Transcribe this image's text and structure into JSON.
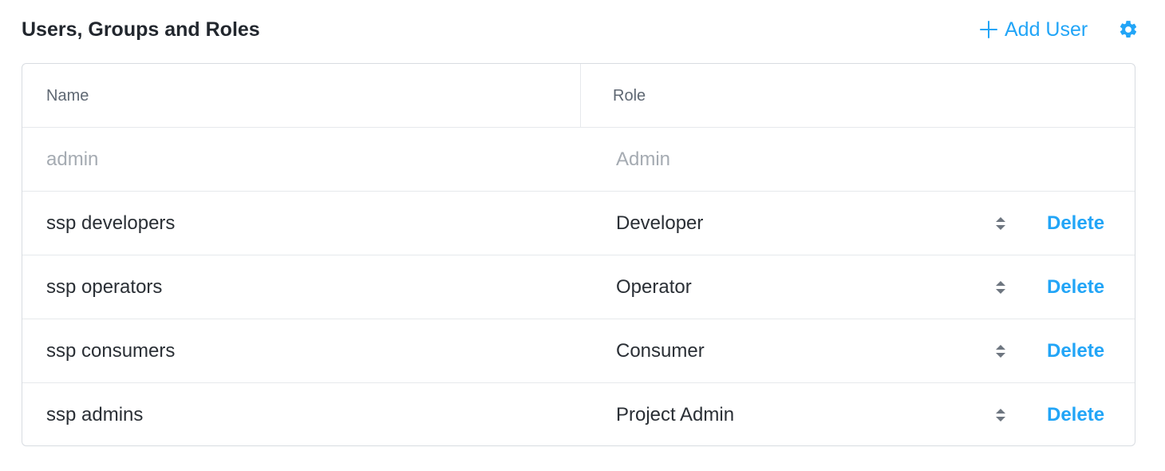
{
  "section": {
    "title": "Users, Groups and Roles",
    "add_user_label": "Add User",
    "add_icon": "plus-icon",
    "settings_icon": "gear-icon"
  },
  "table": {
    "columns": [
      "Name",
      "Role"
    ],
    "rows": [
      {
        "name": "admin",
        "role": "Admin",
        "editable": false
      },
      {
        "name": "ssp developers",
        "role": "Developer",
        "editable": true,
        "action": "Delete"
      },
      {
        "name": "ssp operators",
        "role": "Operator",
        "editable": true,
        "action": "Delete"
      },
      {
        "name": "ssp consumers",
        "role": "Consumer",
        "editable": true,
        "action": "Delete"
      },
      {
        "name": "ssp admins",
        "role": "Project Admin",
        "editable": true,
        "action": "Delete"
      }
    ]
  },
  "colors": {
    "accent": "#22a5f7",
    "text": "#2a2f35",
    "muted": "#a5abb2",
    "border": "#d8dce1"
  }
}
